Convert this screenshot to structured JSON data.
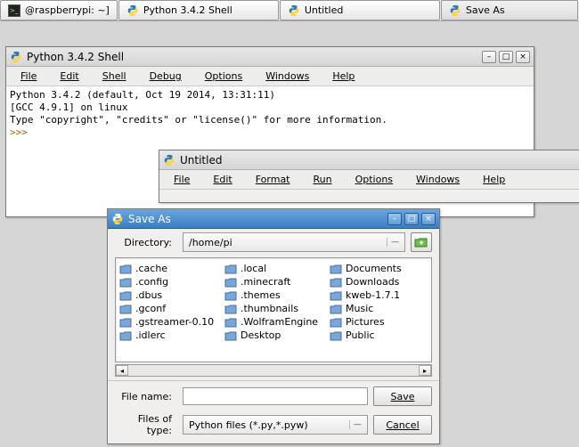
{
  "taskbar": {
    "items": [
      {
        "label": "@raspberrypi: ~]"
      },
      {
        "label": "Python 3.4.2 Shell"
      },
      {
        "label": "Untitled"
      },
      {
        "label": "Save As"
      }
    ]
  },
  "shell_window": {
    "title": "Python 3.4.2 Shell",
    "menus": [
      "File",
      "Edit",
      "Shell",
      "Debug",
      "Options",
      "Windows",
      "Help"
    ],
    "line1": "Python 3.4.2 (default, Oct 19 2014, 13:31:11)",
    "line2": "[GCC 4.9.1] on linux",
    "line3": "Type \"copyright\", \"credits\" or \"license()\" for more information.",
    "prompt": ">>> "
  },
  "editor_window": {
    "title": "Untitled",
    "menus": [
      "File",
      "Edit",
      "Format",
      "Run",
      "Options",
      "Windows",
      "Help"
    ]
  },
  "saveas": {
    "title": "Save As",
    "dir_label": "Directory:",
    "dir_value": "/home/pi",
    "columns": [
      [
        ".cache",
        ".config",
        ".dbus",
        ".gconf",
        ".gstreamer-0.10",
        ".idlerc"
      ],
      [
        ".local",
        ".minecraft",
        ".themes",
        ".thumbnails",
        ".WolframEngine",
        "Desktop"
      ],
      [
        "Documents",
        "Downloads",
        "kweb-1.7.1",
        "Music",
        "Pictures",
        "Public"
      ]
    ],
    "filename_label": "File name:",
    "filename_value": "",
    "filetype_label": "Files of type:",
    "filetype_value": "Python files (*.py,*.pyw)",
    "save_label": "Save",
    "cancel_label": "Cancel"
  }
}
